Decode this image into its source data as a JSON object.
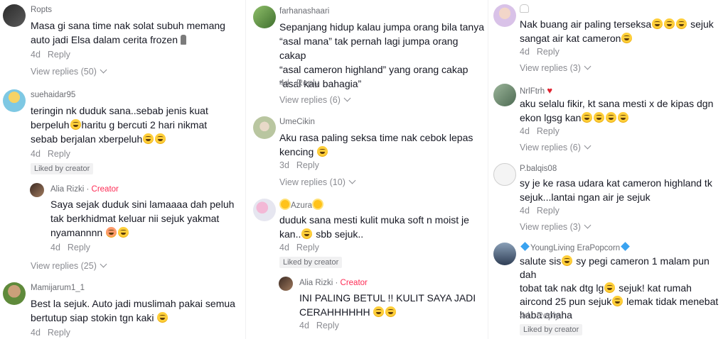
{
  "colors": {
    "creator": "#fe2c55",
    "muted": "#8a8b91",
    "text": "#161823"
  },
  "icons": {
    "chevron": "chevron-down-icon",
    "emoji": "laughing-emoji-icon"
  },
  "col1": {
    "c1": {
      "user": "Ropts",
      "text1": "Masa gi sana time nak solat subuh memang",
      "text2": "auto jadi Elsa dalam cerita frozen",
      "time": "4d",
      "reply": "Reply",
      "view": "View replies (50)"
    },
    "c2": {
      "user": "suehaidar95",
      "text1": "teringin nk duduk sana..sebab jenis kuat",
      "text2a": "berpeluh",
      "text2b": "haritu g bercuti 2 hari nikmat",
      "text3": "sebab berjalan xberpeluh",
      "time": "4d",
      "reply": "Reply",
      "liked": "Liked by creator"
    },
    "r1": {
      "user": "Alia Rizki",
      "creator": "Creator",
      "text1": "Saya sejak duduk sini lamaaaa dah peluh",
      "text2": "tak berkhidmat keluar nii sejuk yakmat",
      "text3": "nyamannnn",
      "time": "4d",
      "reply": "Reply",
      "view": "View replies (25)"
    },
    "c3": {
      "user": "Mamijarum1_1",
      "text1": "Best la sejuk. Auto jadi muslimah pakai semua",
      "text2": "bertutup siap stokin tgn kaki",
      "time": "4d",
      "reply": "Reply"
    }
  },
  "col2": {
    "c1": {
      "user": "farhanashaari",
      "text1": "Sepanjang hidup kalau jumpa orang bila tanya",
      "text2": "“asal mana” tak pernah lagi jumpa orang cakap",
      "text3": "“asal cameron highland” yang orang cakap",
      "text4": "“asal kau bahagia”",
      "time": "4d",
      "reply": "Reply",
      "view": "View replies (6)"
    },
    "c2": {
      "user": "UmeCikin",
      "text1": "Aku rasa paling seksa time nak cebok lepas",
      "text2": "kencing",
      "time": "3d",
      "reply": "Reply",
      "view": "View replies (10)"
    },
    "c3": {
      "user": "Azura",
      "text1": "duduk sana mesti kulit muka soft n moist je",
      "text2a": "kan..",
      "text2b": " sbb sejuk..",
      "time": "4d",
      "reply": "Reply",
      "liked": "Liked by creator"
    },
    "r1": {
      "user": "Alia Rizki",
      "creator": "Creator",
      "text1": "INI PALING BETUL !! KULIT SAYA JADI",
      "text2": "CERAHHHHHH",
      "time": "4d",
      "reply": "Reply"
    }
  },
  "col3": {
    "c1": {
      "text1": "Nak buang air paling terseksa",
      "text1b": " sejuk",
      "text2": "sangat air kat cameron",
      "time": "4d",
      "reply": "Reply",
      "view": "View replies (3)"
    },
    "c2": {
      "user": "NrlFtrh",
      "text1": "aku selalu fikir, kt sana mesti x de kipas dgn",
      "text2": "ekon lgsg kan",
      "time": "4d",
      "reply": "Reply",
      "view": "View replies (6)"
    },
    "c3": {
      "user": "P.balqis08",
      "text1": "sy je ke rasa udara kat cameron highland tk",
      "text2": "sejuk...lantai ngan air je sejuk",
      "time": "4d",
      "reply": "Reply",
      "view": "View replies (3)"
    },
    "c4": {
      "user": "YoungLiving EraPopcorn",
      "text1a": "salute sis",
      "text1b": " sy pegi cameron 1 malam pun dah",
      "text2a": "tobat tak nak dtg lg",
      "text2b": " sejuk! kat rumah",
      "text3a": "aircond 25 pun sejuk",
      "text3b": " lemak tidak menebat",
      "text4": "haba ahaha",
      "time": "4d",
      "reply": "Reply",
      "liked": "Liked by creator"
    }
  }
}
